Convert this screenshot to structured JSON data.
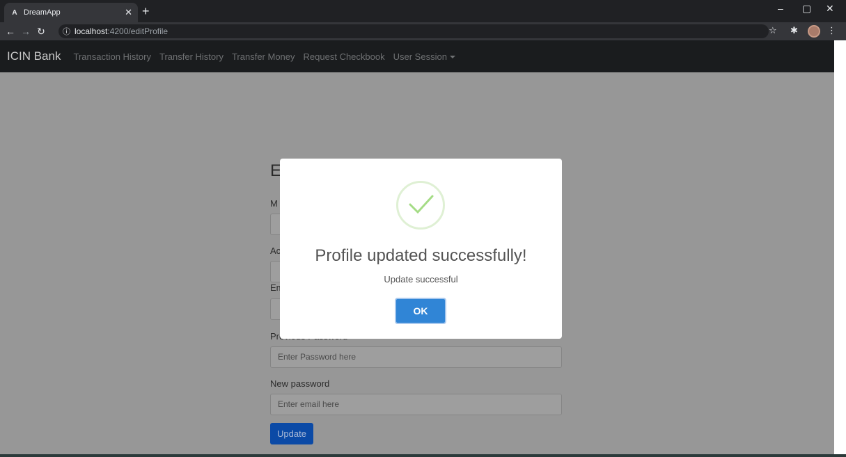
{
  "browser": {
    "tab_title": "DreamApp",
    "tab_favicon": "A",
    "url_host": "localhost",
    "url_path": ":4200/editProfile"
  },
  "navbar": {
    "brand": "ICIN Bank",
    "links": [
      "Transaction History",
      "Transfer History",
      "Transfer Money",
      "Request Checkbook",
      "User Session"
    ]
  },
  "form": {
    "title_visible": "E",
    "label_1_visible": "M",
    "label_2_visible": "Ac",
    "label_3_visible": "Em",
    "label_4_visible": "Previous Password",
    "previous_password_placeholder": "Enter Password here",
    "new_password_label": "New password",
    "new_password_placeholder": "Enter email here",
    "update_label": "Update"
  },
  "modal": {
    "title": "Profile updated successfully!",
    "text": "Update successful",
    "ok_label": "OK",
    "icon": "success-check-icon"
  },
  "colors": {
    "modal_button": "#3085d6",
    "check": "#a5dc86",
    "update_button": "#0b4aa6"
  }
}
